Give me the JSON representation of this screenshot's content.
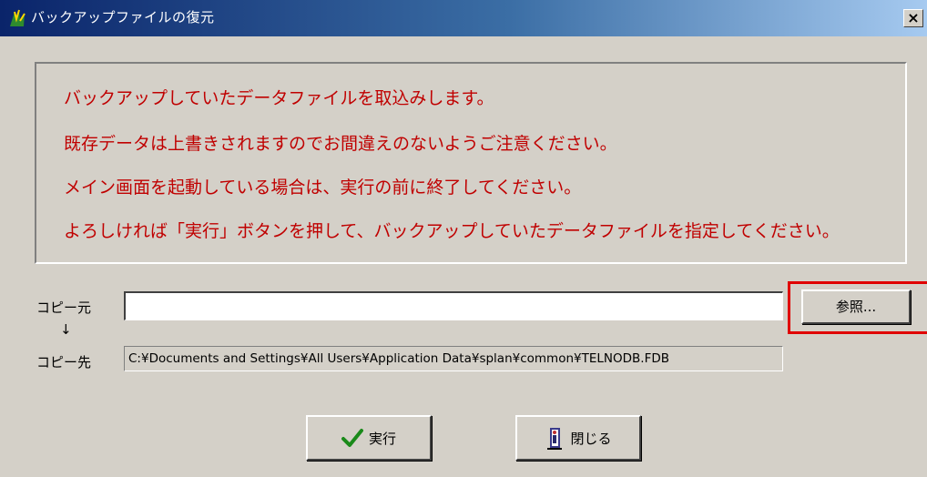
{
  "window": {
    "title": "バックアップファイルの復元",
    "close_glyph": "×",
    "icon": "app-icon"
  },
  "message": {
    "lines": [
      "バックアップしていたデータファイルを取込みします。",
      "既存データは上書きされますのでお間違えのないようご注意ください。",
      "メイン画面を起動している場合は、実行の前に終了してください。",
      "よろしければ「実行」ボタンを押して、バックアップしていたデータファイルを指定してください。"
    ],
    "color": "#c00000"
  },
  "form": {
    "source_label": "コピー元",
    "arrow": "↓",
    "dest_label": "コピー先",
    "source_value": "",
    "dest_value": "C:¥Documents and Settings¥All Users¥Application Data¥splan¥common¥TELNODB.FDB",
    "browse_label": "参照..."
  },
  "buttons": {
    "execute_label": "実行",
    "execute_icon": "checkmark-icon",
    "close_label": "閉じる",
    "close_icon": "door-icon"
  },
  "highlight_color": "#e00000"
}
